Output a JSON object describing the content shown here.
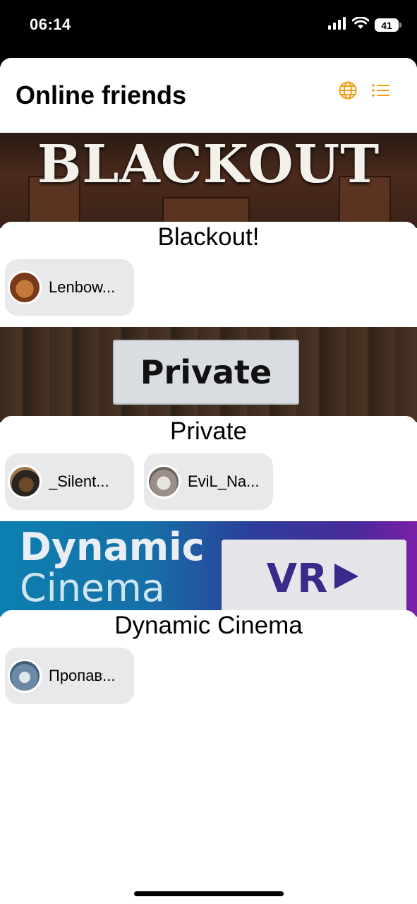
{
  "status_bar": {
    "time": "06:14",
    "battery": "41"
  },
  "header": {
    "title": "Online friends",
    "accent_color": "#f39c12"
  },
  "worlds": [
    {
      "name": "Blackout!",
      "banner_text": "BLACKOUT",
      "friends": [
        {
          "name": "Lenbow..."
        }
      ]
    },
    {
      "name": "Private",
      "banner_text": "Private",
      "friends": [
        {
          "name": "_Silent..."
        },
        {
          "name": "EviL_Na..."
        }
      ]
    },
    {
      "name": "Dynamic Cinema",
      "banner_text_line1": "Dynamic",
      "banner_text_line2": "Cinema",
      "banner_badge": "VR",
      "friends": [
        {
          "name": "Пропав..."
        }
      ]
    }
  ]
}
